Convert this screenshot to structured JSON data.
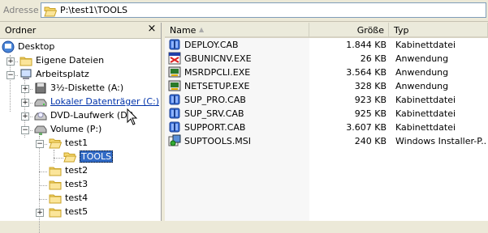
{
  "address": {
    "label": "Adresse",
    "path": "P:\\test1\\TOOLS"
  },
  "tree": {
    "title": "Ordner",
    "close": "×",
    "nodes": [
      {
        "label": "Desktop"
      },
      {
        "label": "Eigene Dateien"
      },
      {
        "label": "Arbeitsplatz"
      },
      {
        "label": "3½-Diskette (A:)"
      },
      {
        "label": "Lokaler Datenträger (C:)"
      },
      {
        "label": "DVD-Laufwerk (D:)"
      },
      {
        "label": "Volume (P:)"
      },
      {
        "label": "test1"
      },
      {
        "label": "TOOLS"
      },
      {
        "label": "test2"
      },
      {
        "label": "test3"
      },
      {
        "label": "test4"
      },
      {
        "label": "test5"
      }
    ]
  },
  "list": {
    "columns": {
      "name": "Name",
      "size": "Größe",
      "type": "Typ"
    },
    "rows": [
      {
        "name": "DEPLOY.CAB",
        "size": "1.844 KB",
        "type": "Kabinettdatei",
        "icon": "cab-icon"
      },
      {
        "name": "GBUNICNV.EXE",
        "size": "26 KB",
        "type": "Anwendung",
        "icon": "exe-icon"
      },
      {
        "name": "MSRDPCLI.EXE",
        "size": "3.564 KB",
        "type": "Anwendung",
        "icon": "setup-exe-icon"
      },
      {
        "name": "NETSETUP.EXE",
        "size": "328 KB",
        "type": "Anwendung",
        "icon": "setup-exe-icon"
      },
      {
        "name": "SUP_PRO.CAB",
        "size": "923 KB",
        "type": "Kabinettdatei",
        "icon": "cab-icon"
      },
      {
        "name": "SUP_SRV.CAB",
        "size": "925 KB",
        "type": "Kabinettdatei",
        "icon": "cab-icon"
      },
      {
        "name": "SUPPORT.CAB",
        "size": "3.607 KB",
        "type": "Kabinettdatei",
        "icon": "cab-icon"
      },
      {
        "name": "SUPTOOLS.MSI",
        "size": "240 KB",
        "type": "Windows Installer-P...",
        "icon": "msi-icon"
      }
    ]
  }
}
